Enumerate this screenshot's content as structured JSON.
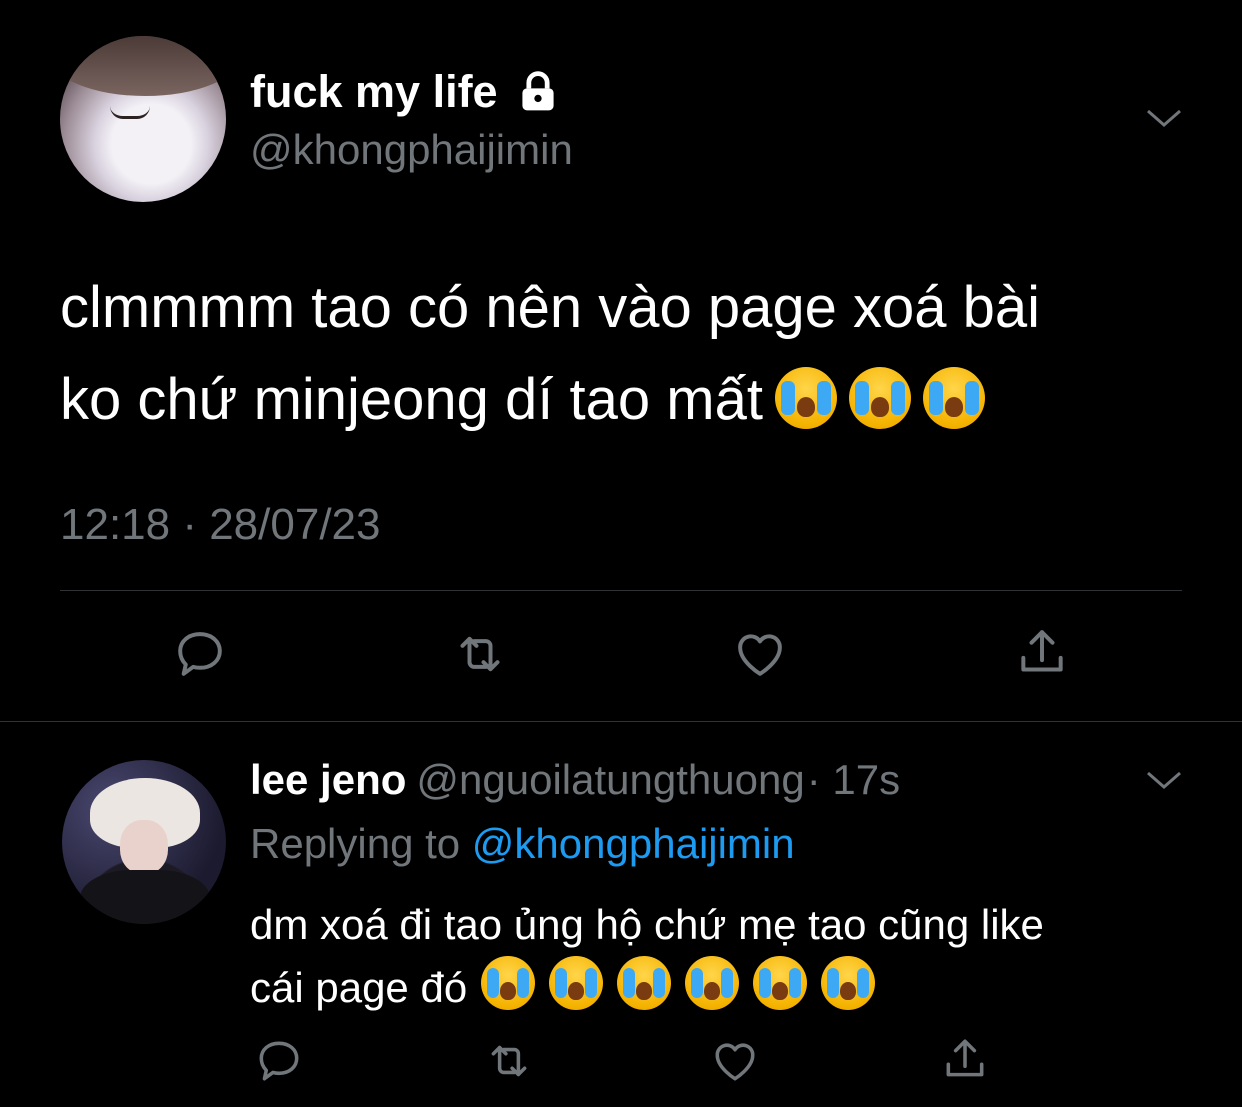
{
  "main_tweet": {
    "display_name": "fuck my life",
    "handle": "@khongphaijimin",
    "text_line1": "clmmmm tao có nên vào page xoá bài",
    "text_line2": "ko chứ minjeong dí tao mất",
    "emojis": [
      "loudly-crying-face",
      "loudly-crying-face",
      "loudly-crying-face"
    ],
    "timestamp": "12:18 · 28/07/23"
  },
  "reply": {
    "display_name": "lee jeno",
    "handle": "@nguoilatungthuong",
    "time": "· 17s",
    "replying_prefix": "Replying to",
    "replying_handle": "@khongphaijimin",
    "text_line1": "dm xoá đi tao ủng hộ chứ mẹ tao cũng like",
    "text_line2": "cái page đó",
    "emojis": [
      "loudly-crying-face",
      "loudly-crying-face",
      "loudly-crying-face",
      "loudly-crying-face",
      "loudly-crying-face",
      "loudly-crying-face"
    ]
  },
  "icons": {
    "lock": "lock-icon",
    "more": "chevron-down-icon",
    "reply": "reply-icon",
    "retweet": "retweet-icon",
    "like": "heart-icon",
    "share": "share-icon"
  },
  "colors": {
    "background": "#000000",
    "text": "#ffffff",
    "secondary": "#71767b",
    "link": "#1d9bf0"
  }
}
